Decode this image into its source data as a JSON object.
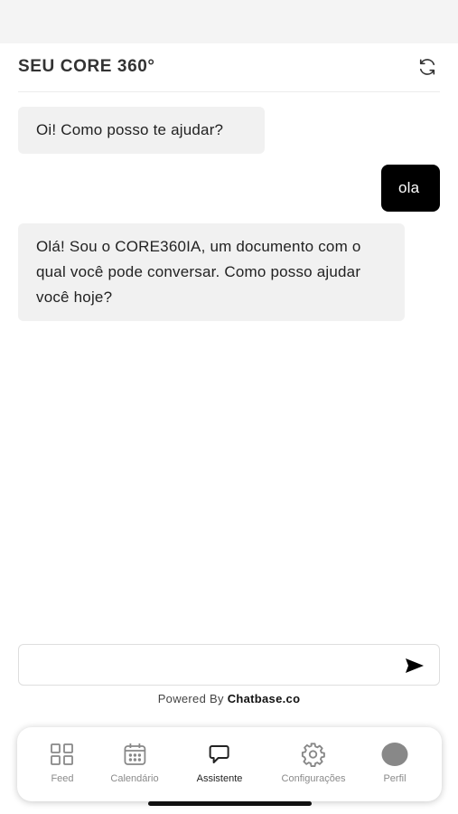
{
  "header": {
    "title": "SEU CORE 360°",
    "refresh_icon": "refresh-icon"
  },
  "messages": [
    {
      "role": "bot",
      "text": "Oi! Como posso te ajudar?"
    },
    {
      "role": "user",
      "text": "ola"
    },
    {
      "role": "bot",
      "text": "Olá! Sou o CORE360IA, um documento com o qual você pode conversar. Como posso ajudar você hoje?"
    }
  ],
  "composer": {
    "value": "",
    "placeholder": "",
    "send_icon": "send-icon"
  },
  "footer": {
    "powered_prefix": "Powered By",
    "powered_brand": "Chatbase.co"
  },
  "tabs": [
    {
      "label": "Feed",
      "icon": "grid-icon",
      "active": false
    },
    {
      "label": "Calendário",
      "icon": "calendar-icon",
      "active": false
    },
    {
      "label": "Assistente",
      "icon": "chat-icon",
      "active": true
    },
    {
      "label": "Configurações",
      "icon": "gear-icon",
      "active": false
    },
    {
      "label": "Perfil",
      "icon": "avatar-icon",
      "active": false
    }
  ],
  "colors": {
    "user_bubble": "#000000",
    "bot_bubble": "#f1f1f1",
    "inactive_tab": "#8a8a8a",
    "active_tab": "#222222"
  }
}
